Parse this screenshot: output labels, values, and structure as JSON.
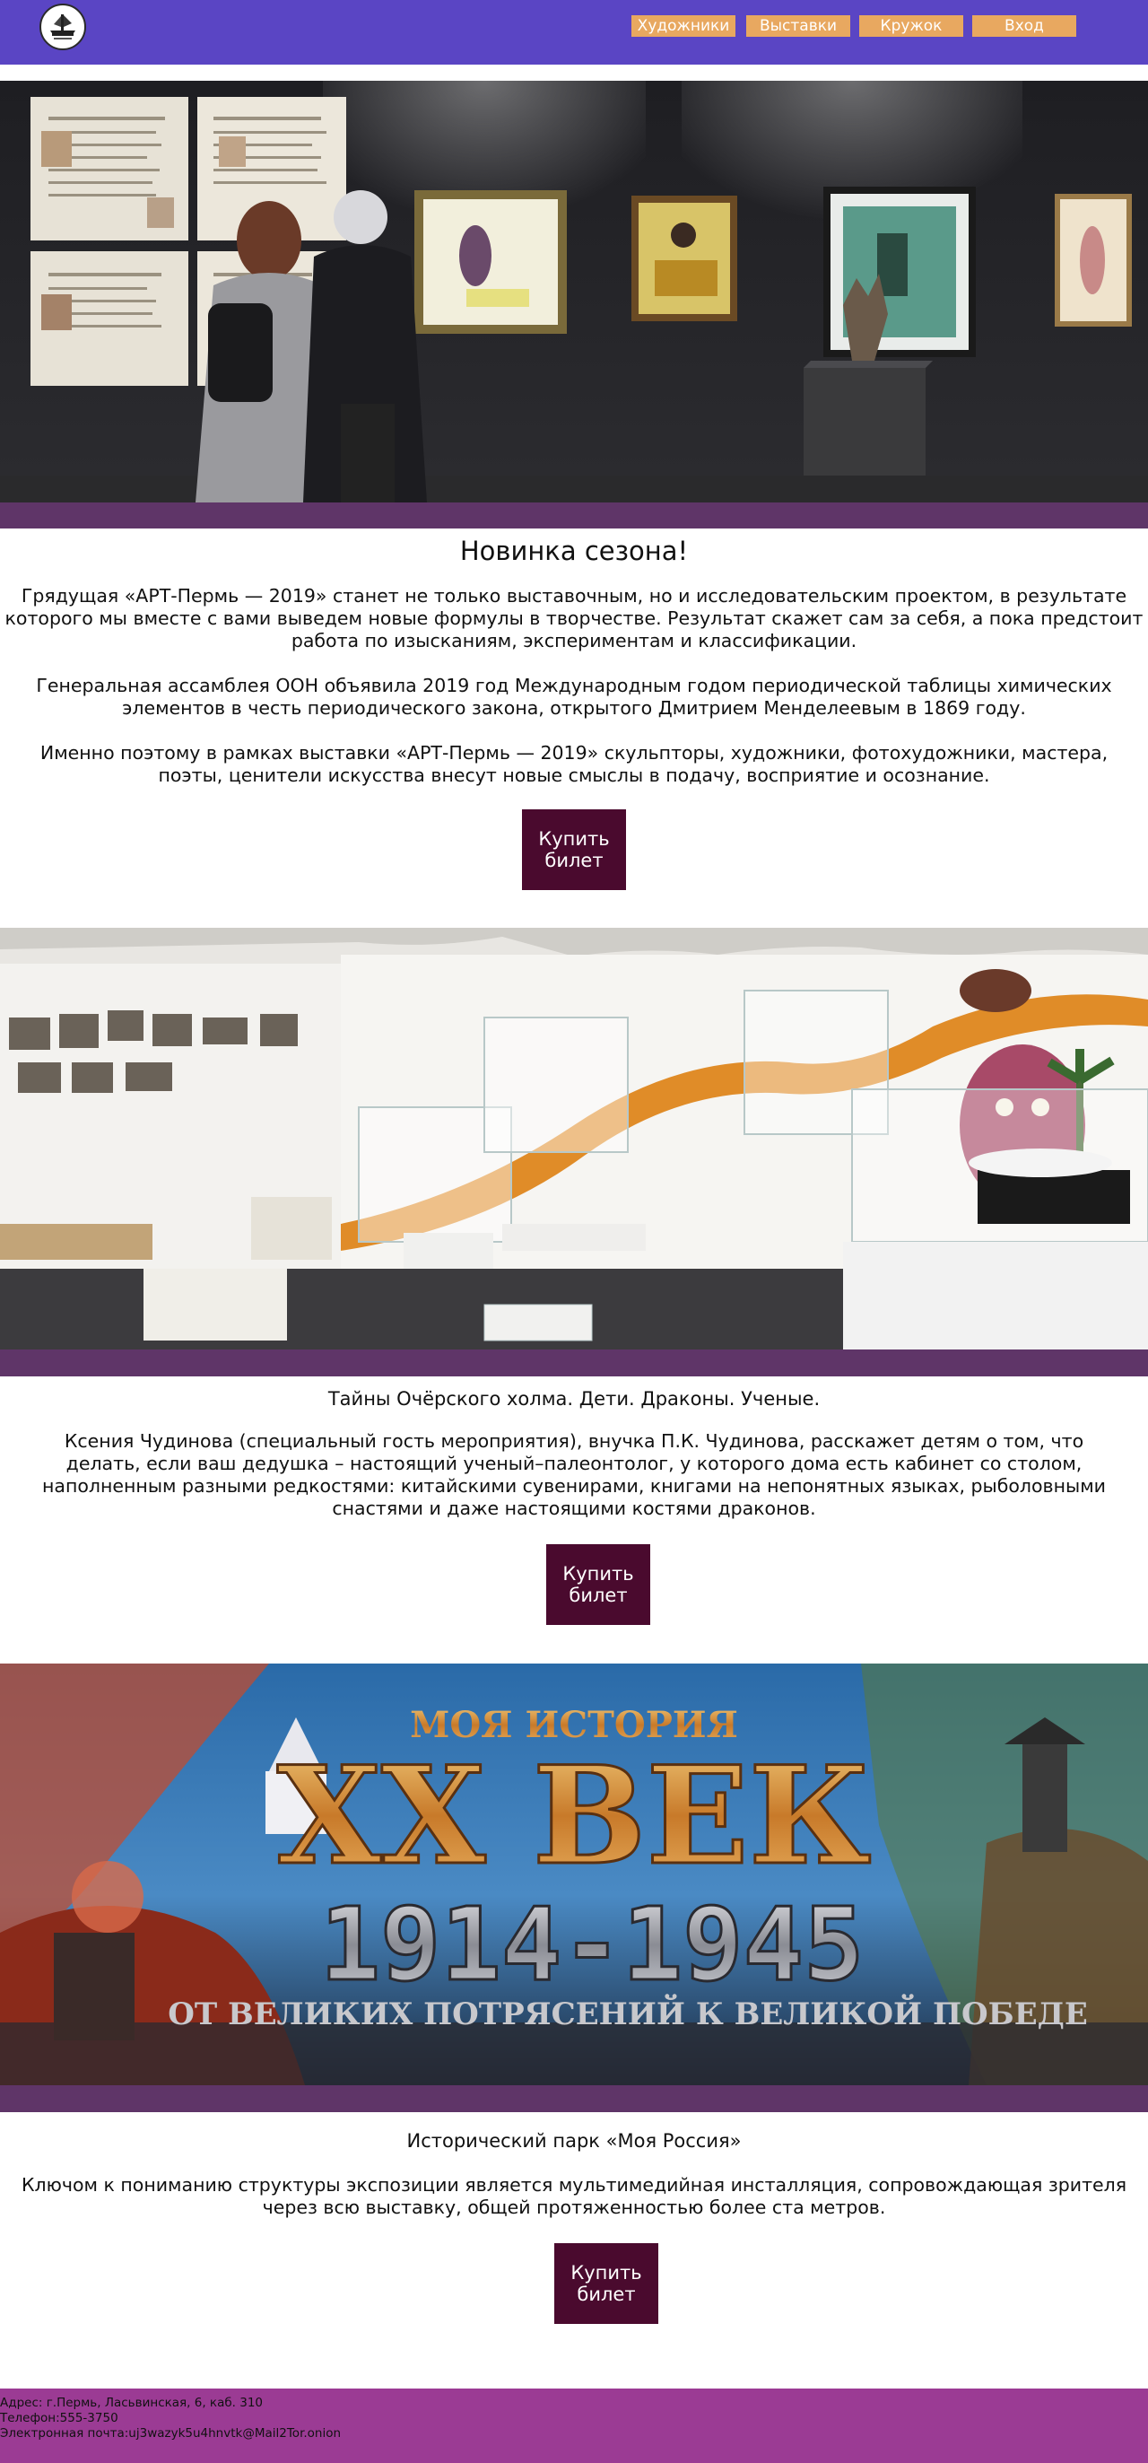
{
  "header": {
    "logo_icon": "ship-emblem-icon",
    "nav": [
      {
        "label": "Художники"
      },
      {
        "label": "Выставки"
      },
      {
        "label": "Кружок"
      },
      {
        "label": "Вход"
      }
    ]
  },
  "colors": {
    "header_bg": "#5a45c4",
    "nav_button_bg": "#e8a860",
    "band": "#5f3568",
    "buy_button_bg": "#4a0a2e",
    "footer_bg": "#9b3b94"
  },
  "sections": [
    {
      "image": "gallery-exhibition-photo",
      "title": "Новинка сезона!",
      "paragraphs": [
        "Грядущая «АРТ-Пермь — 2019» станет не только выставочным, но и исследовательским проектом, в результате которого мы вместе с вами выведем новые формулы в творчестве. Результат скажет сам за себя, а пока предстоит работа по изысканиям, экспериментам и классификации.",
        "Генеральная ассамблея ООН объявила 2019 год Международным годом периодической таблицы химических элементов в честь периодического закона, открытого Дмитрием Менделеевым в 1869 году.",
        "Именно поэтому в рамках выставки «АРТ-Пермь — 2019» скульпторы, художники, фотохудожники, мастера, поэты, ценители искусства внесут новые смыслы в подачу, восприятие и осознание."
      ],
      "button": "Купить\nбилет"
    },
    {
      "image": "museum-display-cases-photo",
      "title": "Тайны Очёрского холма. Дети. Драконы. Ученые.",
      "paragraphs": [
        "Ксения Чудинова (специальный гость мероприятия), внучка П.К. Чудинова, расскажет детям о том, что делать, если ваш дедушка – настоящий ученый–палеонтолог, у которого дома есть кабинет со столом, наполненным разными редкостями: китайскими сувенирами, книгами на непонятных языках, рыболовными снастями и даже настоящими костями драконов."
      ],
      "button": "Купить\nбилет"
    },
    {
      "image": "history-poster-banner",
      "banner_text": {
        "top": "МОЯ ИСТОРИЯ",
        "main": "XX ВЕК",
        "years": "1914-1945",
        "bottom": "ОТ ВЕЛИКИХ ПОТРЯСЕНИЙ К ВЕЛИКОЙ ПОБЕДЕ"
      },
      "title": "Исторический парк «Моя Россия»",
      "paragraphs": [
        "Ключом к пониманию структуры экспозиции является мультимедийная инсталляция, сопровождающая зрителя через всю выставку, общей протяженностью более ста метров."
      ],
      "button": "Купить\nбилет"
    }
  ],
  "footer": {
    "address": "Адрес: г.Пермь, Ласьвинская, 6, каб. 310",
    "phone": "Телефон:555-3750",
    "email": "Электронная почта:uj3wazyk5u4hnvtk@Mail2Tor.onion"
  }
}
